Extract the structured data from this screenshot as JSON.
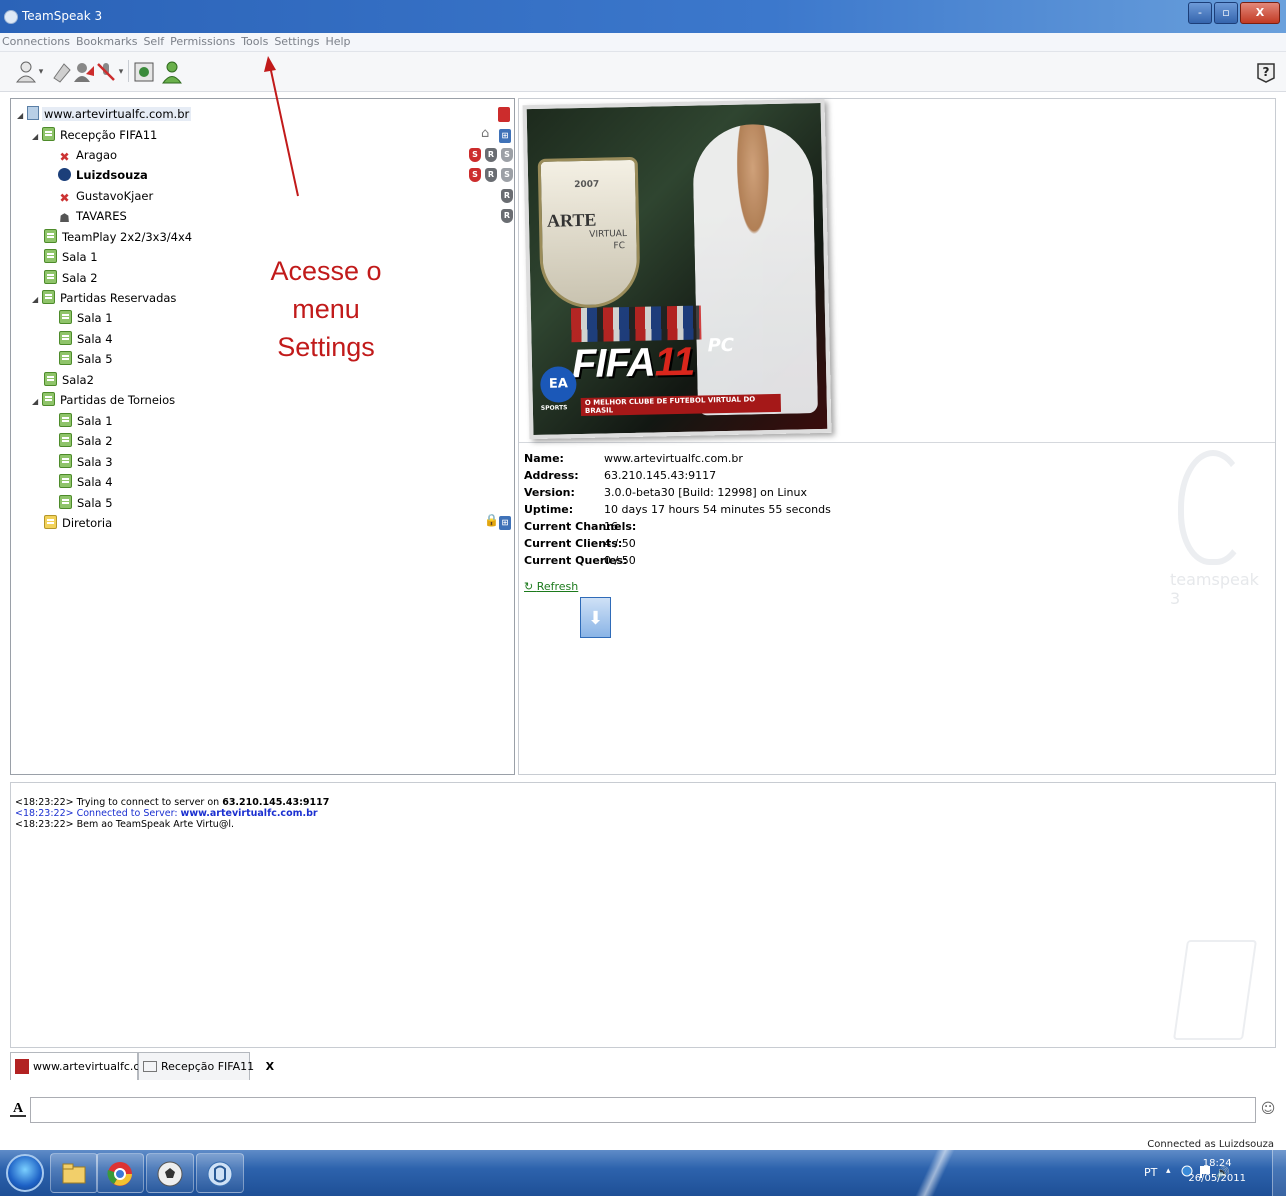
{
  "window": {
    "title": "TeamSpeak 3",
    "buttons": {
      "minimize": "-",
      "maximize": "▫",
      "close": "X"
    }
  },
  "menu": [
    "Connections",
    "Bookmarks",
    "Self",
    "Permissions",
    "Tools",
    "Settings",
    "Help"
  ],
  "toolbar": {
    "icons": [
      "connect-icon",
      "disconnect-icon",
      "away-icon",
      "mute-microphone-icon",
      "mute-speakers-icon",
      "subscribe-icon",
      "contacts-icon",
      "help-icon"
    ]
  },
  "tree": {
    "server": "www.artevirtualfc.com.br",
    "rows": [
      {
        "label": "Recepção FIFA11"
      },
      {
        "label": "Aragao"
      },
      {
        "label": "Luizdsouza"
      },
      {
        "label": "GustavoKjaer"
      },
      {
        "label": "TAVARES"
      },
      {
        "label": "TeamPlay 2x2/3x3/4x4"
      },
      {
        "label": "Sala 1"
      },
      {
        "label": "Sala 2"
      },
      {
        "label": "Partidas Reservadas"
      },
      {
        "label": "Sala 1"
      },
      {
        "label": "Sala 4"
      },
      {
        "label": "Sala 5"
      },
      {
        "label": "Sala2"
      },
      {
        "label": "Partidas de Torneios"
      },
      {
        "label": "Sala 1"
      },
      {
        "label": "Sala 2"
      },
      {
        "label": "Sala 3"
      },
      {
        "label": "Sala 4"
      },
      {
        "label": "Sala 5"
      },
      {
        "label": "Diretoria"
      }
    ],
    "badges": {
      "server_admin": "S",
      "registered": "R"
    }
  },
  "banner": {
    "year": "2007",
    "arte": "ARTE",
    "virtual": "VIRTUAL",
    "fc": "FC",
    "game": "FIFA",
    "game_num": "11",
    "platform": "PC",
    "ea": "EA",
    "ea_sub": "SPORTS",
    "tagline": "O MELHOR CLUBE DE FUTEBOL VIRTUAL DO BRASIL"
  },
  "info": {
    "rows": [
      {
        "key": "Name:",
        "value": "www.artevirtualfc.com.br"
      },
      {
        "key": "Address:",
        "value": "63.210.145.43:9117"
      },
      {
        "key": "Version:",
        "value": "3.0.0-beta30 [Build: 12998] on Linux"
      },
      {
        "key": "Uptime:",
        "value": "10 days 17 hours 54 minutes 55 seconds"
      },
      {
        "key": "Current Channels:",
        "value": "16"
      },
      {
        "key": "Current Clients:",
        "value": "4 / 50"
      },
      {
        "key": "Current Queries:",
        "value": "0 / 50"
      }
    ],
    "refresh": "Refresh",
    "watermark": "teamspeak 3"
  },
  "log": [
    {
      "prefix": "<18:23:22> Trying to connect to server on ",
      "bold": "63.210.145.43:9117",
      "color": "#000000"
    },
    {
      "prefix": "<18:23:22> Connected to Server: ",
      "bold": "www.artevirtualfc.com.br",
      "color": "#1a2fd0"
    },
    {
      "prefix": "<18:23:22> Bem ao TeamSpeak Arte Virtu@l.",
      "bold": "",
      "color": "#000000"
    }
  ],
  "tabs": [
    {
      "label": "www.artevirtualfc.com.br"
    },
    {
      "label": "Recepção FIFA11",
      "close": "X"
    }
  ],
  "chat": {
    "placeholder": ""
  },
  "status": "Connected as Luizdsouza",
  "annotation": {
    "line1": "Acesse o menu",
    "line2": "Settings",
    "color": "#c11a1a"
  },
  "taskbar": {
    "lang": "PT",
    "time": "18:24",
    "date": "26/05/2011"
  }
}
